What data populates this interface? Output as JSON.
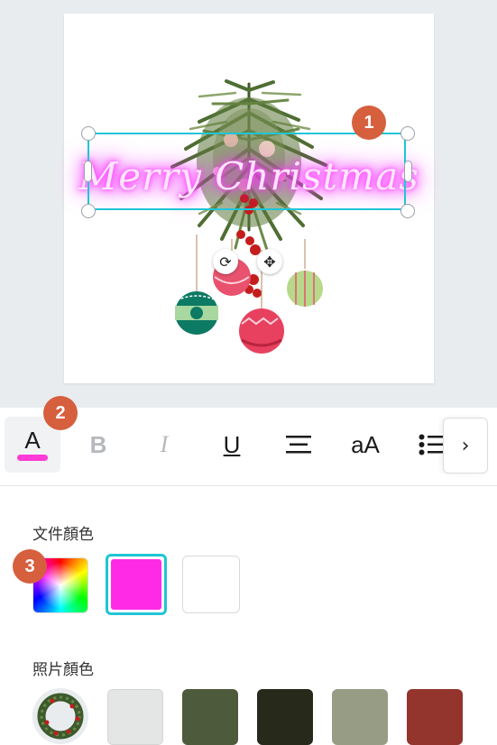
{
  "design": {
    "text_content": "Merry Christmas",
    "neon_color": "#ff33ff",
    "selection_color": "#1fc5d6"
  },
  "badges": {
    "one": "1",
    "two": "2",
    "three": "3"
  },
  "toolbar": {
    "text_color_label": "A",
    "text_color_bar": "#ff3ad6",
    "bold_label": "B",
    "italic_label": "I",
    "underline_label": "U",
    "case_label": "aA",
    "more_icon": "chevron-right-icon"
  },
  "document_colors": {
    "title": "文件顏色",
    "swatches": [
      {
        "type": "color-picker"
      },
      {
        "color": "#ff2ae6",
        "selected": true
      },
      {
        "color": "#ffffff",
        "selected": false
      }
    ]
  },
  "photo_colors": {
    "title": "照片顏色",
    "swatches": [
      {
        "type": "wreath-thumbnail"
      },
      {
        "color": "#e4e6e5"
      },
      {
        "color": "#4d5a3c"
      },
      {
        "color": "#272a1b"
      },
      {
        "color": "#979d84"
      },
      {
        "color": "#93352c"
      }
    ]
  }
}
